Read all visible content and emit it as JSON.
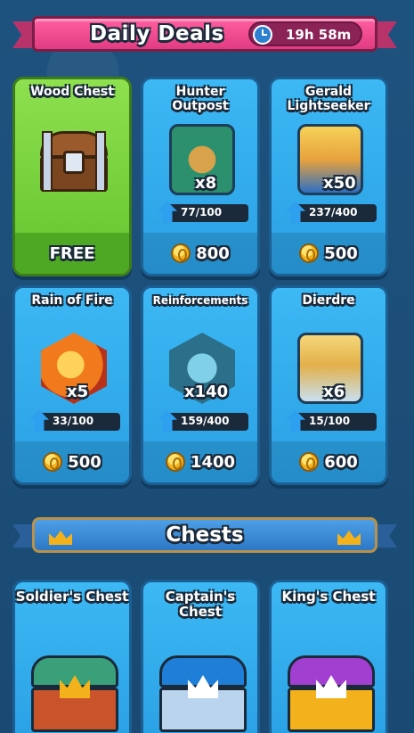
{
  "daily_deals": {
    "title": "Daily Deals",
    "timer": "19h 58m",
    "cards": [
      {
        "name": "Wood Chest",
        "price": "FREE"
      },
      {
        "name": "Hunter Outpost",
        "qty": "x8",
        "progress": "77/100",
        "price": "800"
      },
      {
        "name": "Gerald Lightseeker",
        "qty": "x50",
        "progress": "237/400",
        "price": "500"
      },
      {
        "name": "Rain of Fire",
        "qty": "x5",
        "progress": "33/100",
        "price": "500"
      },
      {
        "name": "Reinforcements",
        "qty": "x140",
        "progress": "159/400",
        "price": "1400"
      },
      {
        "name": "Dierdre",
        "qty": "x6",
        "progress": "15/100",
        "price": "600"
      }
    ]
  },
  "chests": {
    "title": "Chests",
    "items": [
      {
        "name": "Soldier's Chest"
      },
      {
        "name": "Captain's Chest"
      },
      {
        "name": "King's Chest"
      }
    ]
  },
  "colors": {
    "deals_banner": "#e23b82",
    "card_blue": "#2aa0e4",
    "card_green": "#64c42e",
    "coin": "#f3b21c"
  },
  "icons": [
    "clock-icon",
    "coin-icon",
    "upgrade-arrow-icon",
    "crown-icon",
    "chest-icon"
  ]
}
